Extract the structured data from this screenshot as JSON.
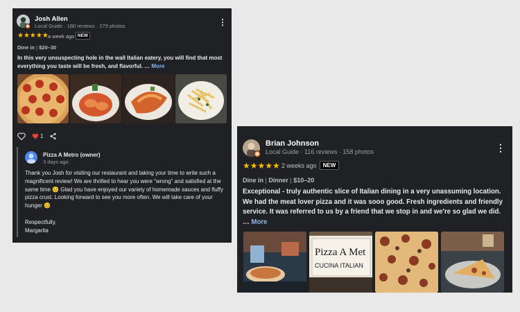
{
  "review1": {
    "author": "Josh Allen",
    "meta": "Local Guide · 180 reviews · 279 photos",
    "stars": "★★★★★",
    "time": "a week ago",
    "badge": "NEW",
    "details": [
      "Dine in",
      "$20–30"
    ],
    "text": "In this very unsuspecting hole in the wall Italian eatery, you will find that most everything you taste will be fresh, and flavorful. …",
    "more": "More",
    "photos": [
      "pepperoni-pizza-icon",
      "ravioli-plate-icon",
      "lasagna-plate-icon",
      "pasta-plate-icon"
    ],
    "like_count": "1",
    "owner_reply": {
      "name": "Pizza A Metro (owner)",
      "time": "3 days ago",
      "text": "Thank you Josh for visiting our restaurant and taking your time to write such a magnificent review! We are thrilled to hear you were “wrong” and satisfied at the same time 😊 Glad you have enjoyed our variety of homemade sauces and fluffy pizza crust. Looking forward to see you more often. We will take care of your hunger 😊",
      "signoff": "Respectfully,",
      "signature": "Margarita"
    }
  },
  "review2": {
    "author": "Brian Johnson",
    "meta": "Local Guide · 116 reviews · 158 photos",
    "stars": "★★★★★",
    "time": "2 weeks ago",
    "badge": "NEW",
    "details": [
      "Dine in",
      "Dinner",
      "$10–20"
    ],
    "text": "Exceptional - truly authentic slice of Italian dining in a very unassuming location. We had the meat lover pizza and it was sooo good. Fresh ingredients and friendly service. It was referred to us by a friend that we stop in and we're so glad we did.",
    "more_prefix": "…",
    "more": "More",
    "photos": [
      "restaurant-interior-icon",
      "restaurant-sign-icon",
      "meat-pizza-icon",
      "pizza-slice-icon"
    ],
    "sign_text_line1": "Pizza A Met",
    "sign_text_line2": "CUCINA ITALIAN"
  },
  "colors": {
    "stars": "#fbbc04",
    "link": "#8ab4f8",
    "card_bg": "#202124",
    "page_bg": "#e9e9e9"
  }
}
